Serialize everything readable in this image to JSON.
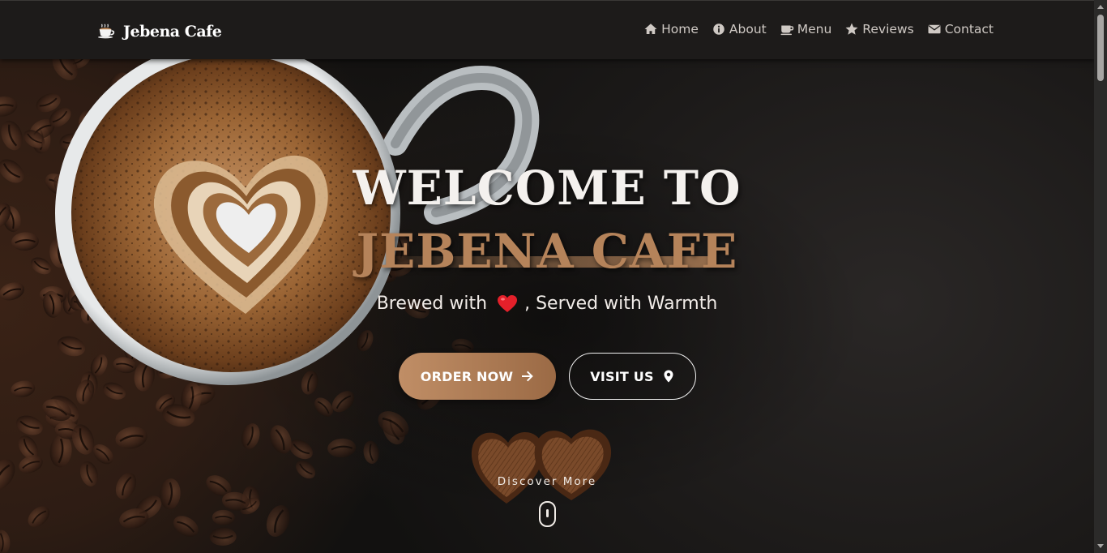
{
  "brand": {
    "name": "Jebena Cafe",
    "icon": "coffee-cup-icon"
  },
  "nav": {
    "items": [
      {
        "label": "Home",
        "icon": "home-icon"
      },
      {
        "label": "About",
        "icon": "info-icon"
      },
      {
        "label": "Menu",
        "icon": "mug-icon"
      },
      {
        "label": "Reviews",
        "icon": "star-icon"
      },
      {
        "label": "Contact",
        "icon": "envelope-icon"
      }
    ]
  },
  "hero": {
    "title_line_1": "WELCOME TO",
    "title_line_2": "JEBENA CAFE",
    "tagline_before": "Brewed with",
    "tagline_after": ", Served with Warmth",
    "order_button": "ORDER NOW",
    "visit_button": "VISIT US",
    "discover": "Discover More"
  },
  "colors": {
    "accent": "#b5835a",
    "navbar_bg": "#1d1b1a",
    "nav_text": "#cfc9c4"
  }
}
